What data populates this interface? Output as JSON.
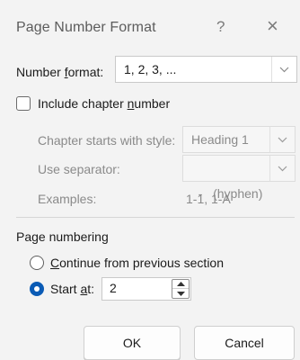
{
  "dialog": {
    "title": "Page Number Format",
    "help": "?",
    "close": "×"
  },
  "number_format": {
    "label_pre": "Number ",
    "label_mnemonic": "f",
    "label_post": "ormat:",
    "value": "1, 2, 3, ..."
  },
  "chapter": {
    "include_label_pre": "Include chapter ",
    "include_mnemonic": "n",
    "include_label_post": "umber",
    "include_checked": false,
    "starts_with_label": "Chapter starts with style:",
    "starts_with_value": "Heading 1",
    "separator_label": "Use separator:",
    "separator_value": "-   (hyphen)",
    "examples_label": "Examples:",
    "examples_value": "1-1, 1-A"
  },
  "page_numbering": {
    "heading": "Page numbering",
    "continue_mnemonic": "C",
    "continue_label_post": "ontinue from previous section",
    "continue_selected": false,
    "start_label_pre": "Start ",
    "start_mnemonic": "a",
    "start_label_post": "t:",
    "start_selected": true,
    "start_value": "2"
  },
  "buttons": {
    "ok": "OK",
    "cancel": "Cancel"
  }
}
